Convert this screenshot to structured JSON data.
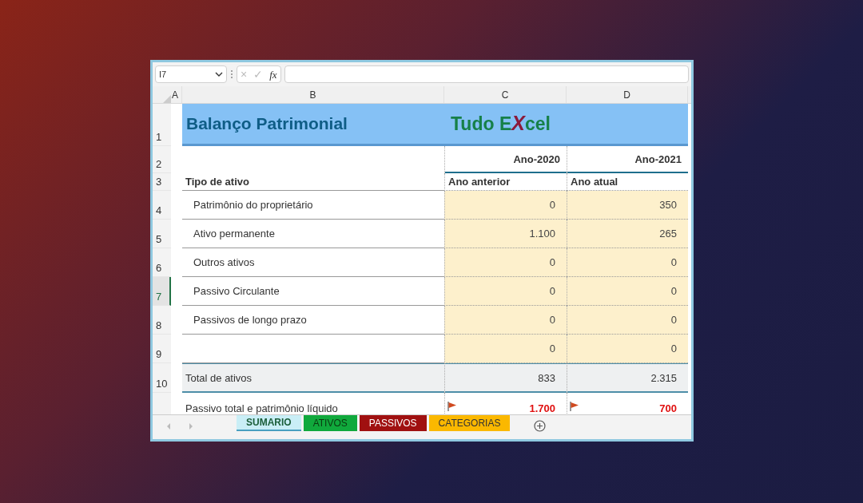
{
  "name_box": {
    "value": "I7"
  },
  "formula_bar": {
    "icons": [
      "×",
      "✓",
      "fx"
    ]
  },
  "columns": [
    {
      "label": "A"
    },
    {
      "label": "B"
    },
    {
      "label": "C"
    },
    {
      "label": "D"
    }
  ],
  "rows": [
    {
      "number": "1",
      "kind": "title",
      "selected": false,
      "title": "Balanço Patrimonial",
      "logo": [
        {
          "text": "Tudo E",
          "kind": "plain"
        },
        {
          "text": "X",
          "kind": "accent"
        },
        {
          "text": "cel",
          "kind": "plain"
        }
      ]
    },
    {
      "number": "2",
      "kind": "years",
      "selected": false,
      "cells": [
        "",
        "Ano-2020",
        "Ano-2021"
      ]
    },
    {
      "number": "3",
      "kind": "header",
      "selected": false,
      "cells": [
        "Tipo de ativo",
        "Ano anterior",
        "Ano atual"
      ]
    },
    {
      "number": "4",
      "kind": "data",
      "selected": false,
      "cells": [
        "Patrimônio do proprietário",
        "0",
        "350"
      ]
    },
    {
      "number": "5",
      "kind": "data",
      "selected": false,
      "cells": [
        "Ativo permanente",
        "1.100",
        "265"
      ]
    },
    {
      "number": "6",
      "kind": "data",
      "selected": false,
      "cells": [
        "Outros ativos",
        "0",
        "0"
      ]
    },
    {
      "number": "7",
      "kind": "data",
      "selected": true,
      "cells": [
        "Passivo Circulante",
        "0",
        "0"
      ]
    },
    {
      "number": "8",
      "kind": "data",
      "selected": false,
      "cells": [
        "Passivos de longo prazo",
        "0",
        "0"
      ]
    },
    {
      "number": "9",
      "kind": "data",
      "selected": false,
      "cells": [
        "",
        "0",
        "0"
      ]
    },
    {
      "number": "10",
      "kind": "total",
      "selected": false,
      "cells": [
        "Total de ativos",
        "833",
        "2.315"
      ]
    },
    {
      "kind": "summary",
      "selected": false,
      "cells": [
        "Passivo total e patrimônio líquido",
        "1.700",
        "700"
      ],
      "flags": [
        false,
        true,
        true
      ]
    }
  ],
  "sheet_tabs": [
    {
      "label": "SUMARIO",
      "color": "#c9eef6",
      "selected": true
    },
    {
      "label": "ATIVOS",
      "color": "#10a93c",
      "selected": false
    },
    {
      "label": "PASSIVOS",
      "color": "#a01010",
      "selected": false
    },
    {
      "label": "CATEGORIAS",
      "color": "#fbb800",
      "selected": false
    }
  ]
}
